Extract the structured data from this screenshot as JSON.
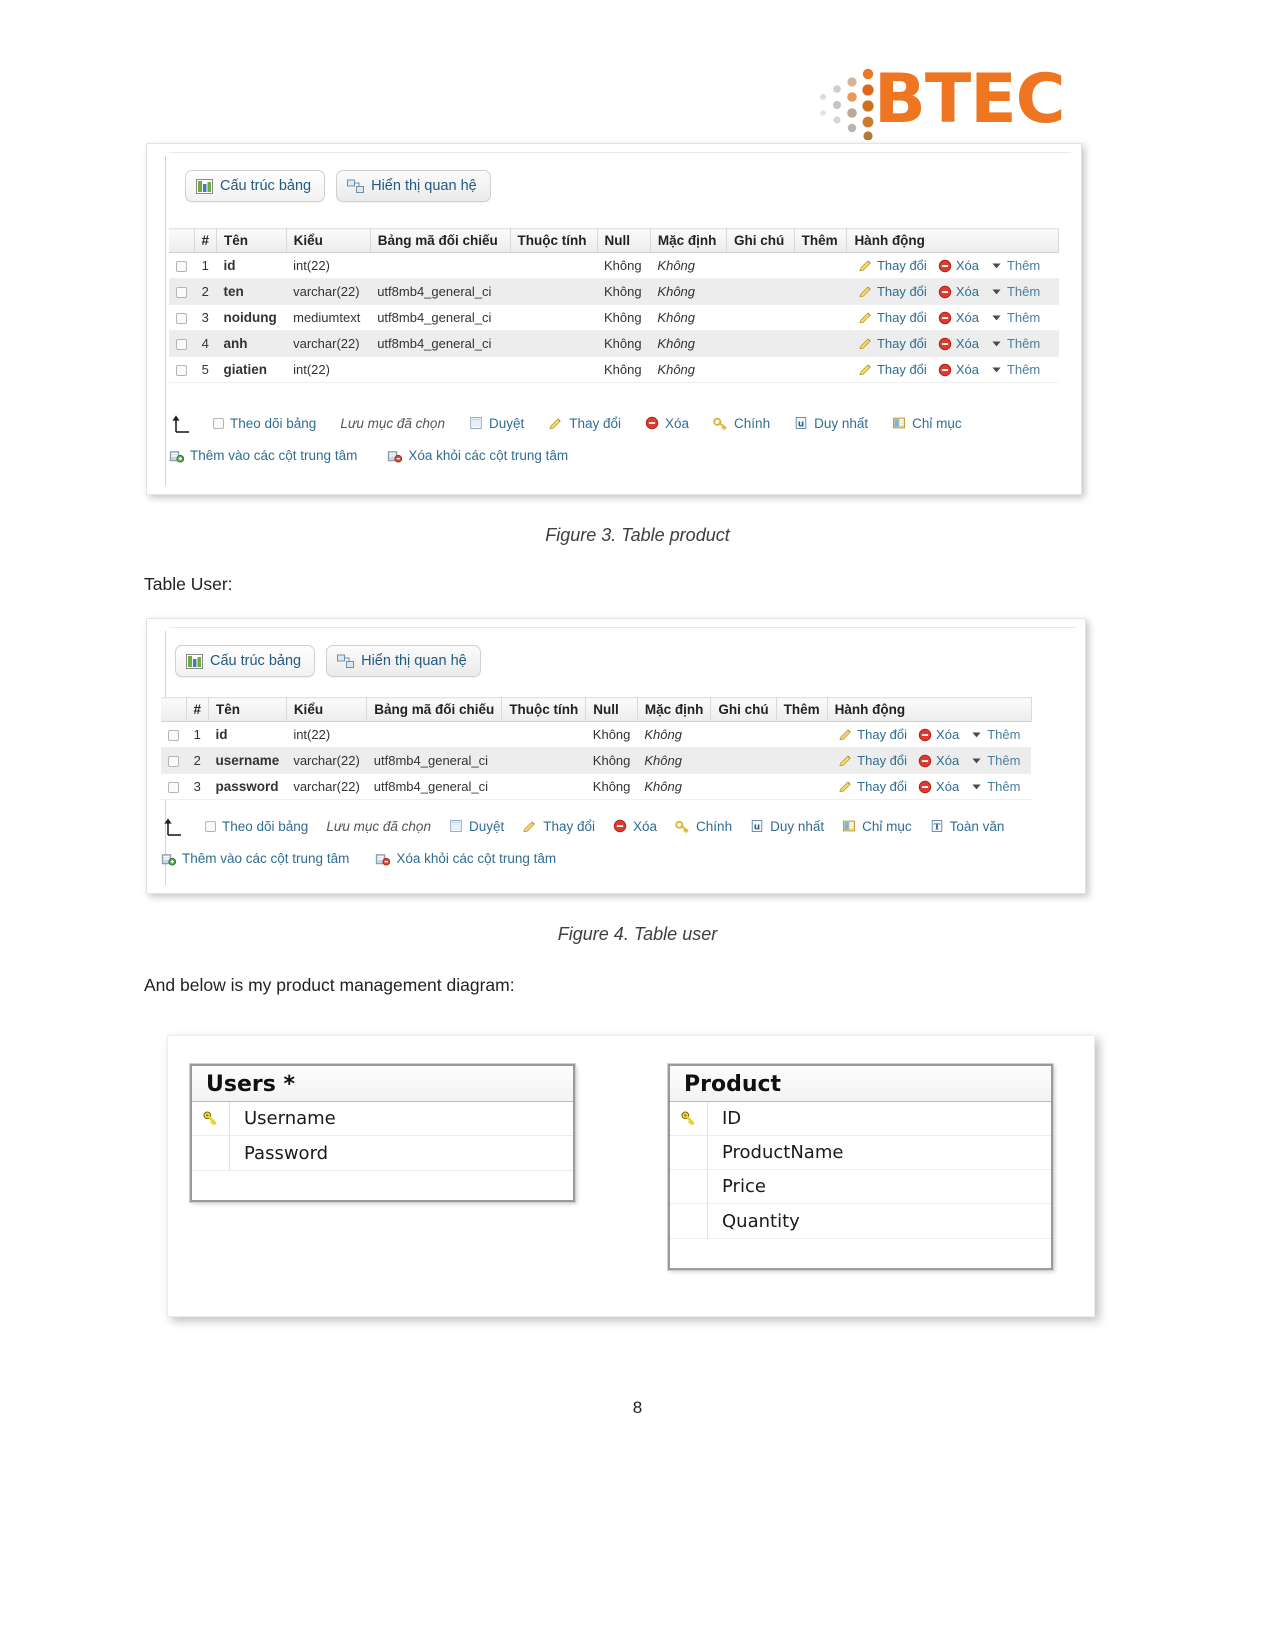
{
  "logo": {
    "text": "BTEC",
    "color": "#EE7623",
    "icon": "btec-dot-matrix-logo"
  },
  "figure3": {
    "caption": "Figure 3. Table product",
    "tabs": [
      {
        "label": "Cấu trúc bảng",
        "icon": "table-structure-icon"
      },
      {
        "label": "Hiển thị quan hệ",
        "icon": "relation-view-icon"
      }
    ],
    "columns": [
      "#",
      "Tên",
      "Kiểu",
      "Bảng mã đối chiếu",
      "Thuộc tính",
      "Null",
      "Mặc định",
      "Ghi chú",
      "Thêm",
      "Hành động"
    ],
    "rows": [
      {
        "num": "1",
        "name": "id",
        "type": "int(22)",
        "collation": "",
        "attributes": "",
        "null": "Không",
        "default": "Không",
        "comment": "",
        "extra": ""
      },
      {
        "num": "2",
        "name": "ten",
        "type": "varchar(22)",
        "collation": "utf8mb4_general_ci",
        "attributes": "",
        "null": "Không",
        "default": "Không",
        "comment": "",
        "extra": ""
      },
      {
        "num": "3",
        "name": "noidung",
        "type": "mediumtext",
        "collation": "utf8mb4_general_ci",
        "attributes": "",
        "null": "Không",
        "default": "Không",
        "comment": "",
        "extra": ""
      },
      {
        "num": "4",
        "name": "anh",
        "type": "varchar(22)",
        "collation": "utf8mb4_general_ci",
        "attributes": "",
        "null": "Không",
        "default": "Không",
        "comment": "",
        "extra": ""
      },
      {
        "num": "5",
        "name": "giatien",
        "type": "int(22)",
        "collation": "",
        "attributes": "",
        "null": "Không",
        "default": "Không",
        "comment": "",
        "extra": ""
      }
    ],
    "row_actions": {
      "change": "Thay đổi",
      "drop": "Xóa",
      "more": "Thêm"
    },
    "footer_row1": [
      {
        "label": "Theo dõi bảng",
        "icon": "checkbox-icon"
      },
      {
        "label": "Lưu mục đã chọn",
        "icon": "none"
      },
      {
        "label": "Duyệt",
        "icon": "browse-icon"
      },
      {
        "label": "Thay đổi",
        "icon": "pencil-icon"
      },
      {
        "label": "Xóa",
        "icon": "delete-icon"
      },
      {
        "label": "Chính",
        "icon": "primary-key-icon"
      },
      {
        "label": "Duy nhất",
        "icon": "unique-icon"
      },
      {
        "label": "Chỉ mục",
        "icon": "index-icon"
      }
    ],
    "footer_row2": [
      {
        "label": "Thêm vào các cột trung tâm",
        "icon": "add-central-columns-icon"
      },
      {
        "label": "Xóa khỏi các cột trung tâm",
        "icon": "remove-central-columns-icon"
      }
    ]
  },
  "text_table_user": "Table User:",
  "figure4": {
    "caption": "Figure 4. Table user",
    "tabs": [
      {
        "label": "Cấu trúc bảng",
        "icon": "table-structure-icon"
      },
      {
        "label": "Hiển thị quan hệ",
        "icon": "relation-view-icon"
      }
    ],
    "columns": [
      "#",
      "Tên",
      "Kiểu",
      "Bảng mã đối chiếu",
      "Thuộc tính",
      "Null",
      "Mặc định",
      "Ghi chú",
      "Thêm",
      "Hành động"
    ],
    "rows": [
      {
        "num": "1",
        "name": "id",
        "type": "int(22)",
        "collation": "",
        "attributes": "",
        "null": "Không",
        "default": "Không",
        "comment": "",
        "extra": ""
      },
      {
        "num": "2",
        "name": "username",
        "type": "varchar(22)",
        "collation": "utf8mb4_general_ci",
        "attributes": "",
        "null": "Không",
        "default": "Không",
        "comment": "",
        "extra": ""
      },
      {
        "num": "3",
        "name": "password",
        "type": "varchar(22)",
        "collation": "utf8mb4_general_ci",
        "attributes": "",
        "null": "Không",
        "default": "Không",
        "comment": "",
        "extra": ""
      }
    ],
    "row_actions": {
      "change": "Thay đổi",
      "drop": "Xóa",
      "more": "Thêm"
    },
    "footer_row1": [
      {
        "label": "Theo dõi bảng",
        "icon": "checkbox-icon"
      },
      {
        "label": "Lưu mục đã chọn",
        "icon": "none"
      },
      {
        "label": "Duyệt",
        "icon": "browse-icon"
      },
      {
        "label": "Thay đổi",
        "icon": "pencil-icon"
      },
      {
        "label": "Xóa",
        "icon": "delete-icon"
      },
      {
        "label": "Chính",
        "icon": "primary-key-icon"
      },
      {
        "label": "Duy nhất",
        "icon": "unique-icon"
      },
      {
        "label": "Chỉ mục",
        "icon": "index-icon"
      },
      {
        "label": "Toàn văn",
        "icon": "fulltext-icon"
      }
    ],
    "footer_row2": [
      {
        "label": "Thêm vào các cột trung tâm",
        "icon": "add-central-columns-icon"
      },
      {
        "label": "Xóa khỏi các cột trung tâm",
        "icon": "remove-central-columns-icon"
      }
    ]
  },
  "text_diagram_intro": "And below is my product management diagram:",
  "diagram": {
    "entities": [
      {
        "title": "Users *",
        "fields": [
          {
            "name": "Username",
            "key": true
          },
          {
            "name": "Password",
            "key": false
          }
        ]
      },
      {
        "title": "Product",
        "fields": [
          {
            "name": "ID",
            "key": true
          },
          {
            "name": "ProductName",
            "key": false
          },
          {
            "name": "Price",
            "key": false
          },
          {
            "name": "Quantity",
            "key": false
          }
        ]
      }
    ]
  },
  "page_number": "8"
}
